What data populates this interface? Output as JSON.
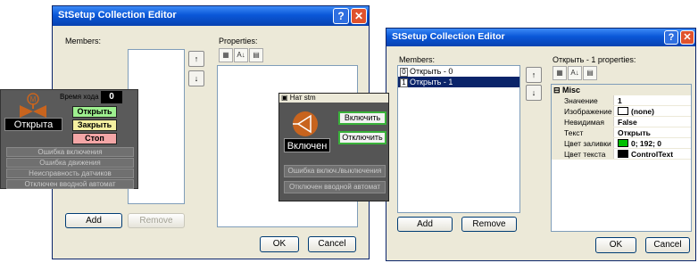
{
  "left_window": {
    "title": "StSetup Collection Editor",
    "members_label": "Members:",
    "properties_label": "Properties:",
    "up_arrow": "↑",
    "down_arrow": "↓",
    "add_label": "Add",
    "remove_label": "Remove",
    "ok_label": "OK",
    "cancel_label": "Cancel"
  },
  "right_window": {
    "title": "StSetup Collection Editor",
    "members_label": "Members:",
    "properties_label": "Открыть - 1 properties:",
    "members": [
      {
        "index": "0",
        "name": "Открыть - 0",
        "selected": false
      },
      {
        "index": "1",
        "name": "Открыть - 1",
        "selected": true
      }
    ],
    "up_arrow": "↑",
    "down_arrow": "↓",
    "category": "Misc",
    "properties": [
      {
        "key": "Значение",
        "value": "1",
        "bold": true
      },
      {
        "key": "Изображение",
        "value": "(none)",
        "swatch": "#ffffff",
        "bold": true
      },
      {
        "key": "Невидимая",
        "value": "False",
        "bold": true
      },
      {
        "key": "Текст",
        "value": "Открыть",
        "bold": true
      },
      {
        "key": "Цвет заливки",
        "value": "0; 192; 0",
        "swatch": "#00c000",
        "bold": true
      },
      {
        "key": "Цвет текста",
        "value": "ControlText",
        "swatch": "#000000",
        "bold": true
      }
    ],
    "add_label": "Add",
    "remove_label": "Remove",
    "ok_label": "OK",
    "cancel_label": "Cancel"
  },
  "valve_panel": {
    "time_label": "Время хода",
    "time_value": "0",
    "valve_letter": "M",
    "open_btn": "Открыть",
    "close_btn": "Закрыть",
    "stop_btn": "Стоп",
    "state": "Открыта",
    "errors": [
      "Ошибка включения",
      "Ошибка движения",
      "Неисправность датчиков",
      "Отключен вводной автомат"
    ],
    "colors": {
      "open": "#9ef08f",
      "close": "#f5f0a0",
      "stop": "#f4a6a6",
      "valve": "#c8641e"
    }
  },
  "pump_popup": {
    "title": "Нат stm",
    "on_btn": "Включить",
    "off_btn": "Отключить",
    "state": "Включен",
    "errors": [
      "Ошибка включ./выключения",
      "Отключен вводной автомат"
    ],
    "colors": {
      "pump": "#c8641e"
    }
  }
}
